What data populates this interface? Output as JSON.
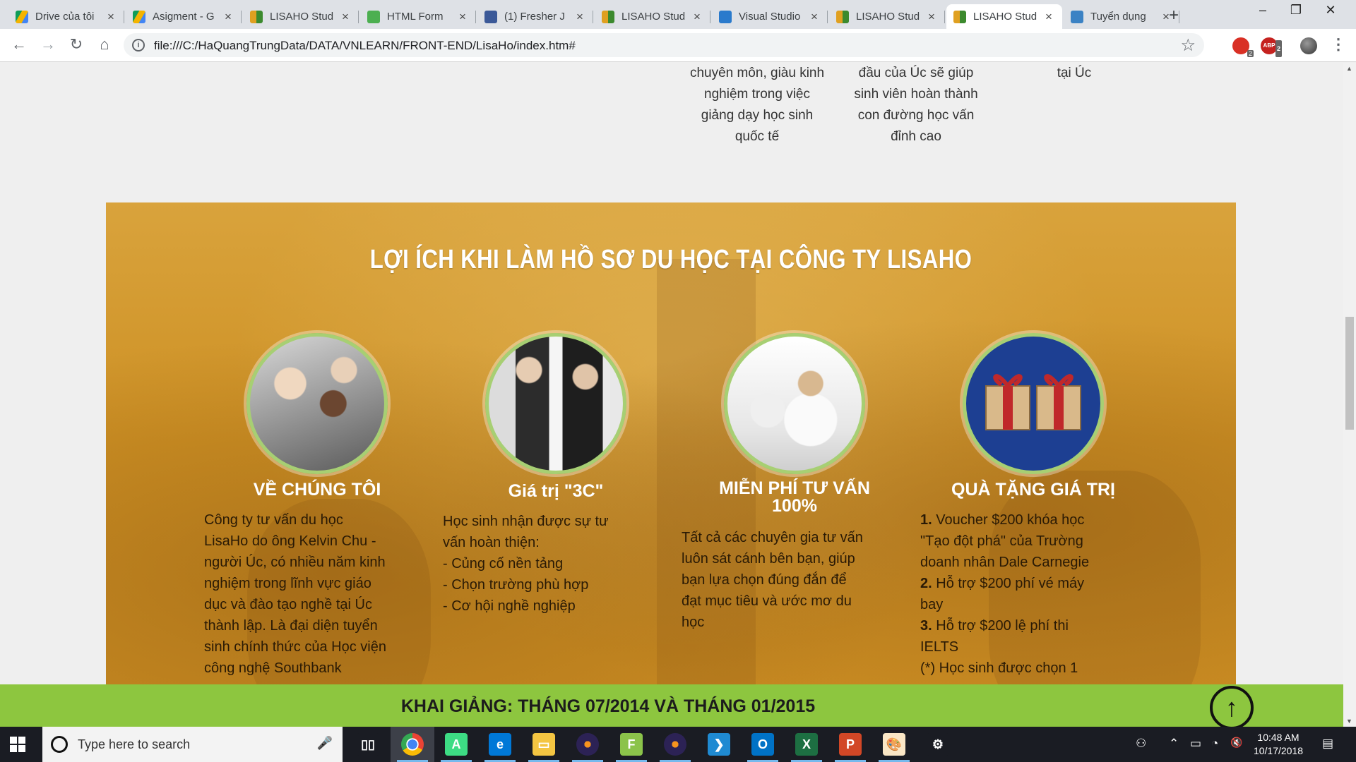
{
  "browser": {
    "tabs": [
      {
        "title": "Drive của tôi",
        "icon": "google-drive-icon",
        "close": "×"
      },
      {
        "title": "Asigment - G",
        "icon": "google-drive-icon",
        "close": "×"
      },
      {
        "title": "LISAHO Stud",
        "icon": "lisaho-favicon",
        "close": "×"
      },
      {
        "title": "HTML Form",
        "icon": "w3schools-favicon",
        "close": "×"
      },
      {
        "title": "(1) Fresher J",
        "icon": "facebook-favicon",
        "close": "×"
      },
      {
        "title": "LISAHO Stud",
        "icon": "lisaho-favicon",
        "close": "×"
      },
      {
        "title": "Visual Studio",
        "icon": "vscode-favicon",
        "close": "×"
      },
      {
        "title": "LISAHO Stud",
        "icon": "lisaho-favicon",
        "close": "×"
      },
      {
        "title": "LISAHO Stud",
        "icon": "lisaho-favicon",
        "close": "×",
        "active": true
      },
      {
        "title": "Tuyển dụng",
        "icon": "binoculars-favicon",
        "close": "×"
      }
    ],
    "new_tab": "+",
    "window_controls": {
      "minimize": "–",
      "restore": "❐",
      "close": "✕"
    },
    "nav": {
      "back": "←",
      "forward": "→",
      "reload": "↻",
      "home": "⌂"
    },
    "url": "file:///C:/HaQuangTrungData/DATA/VNLEARN/FRONT-END/LisaHo/index.htm#",
    "info_icon": "i",
    "bookmark_star": "☆",
    "extensions": [
      {
        "name": "extension-icon-1",
        "badge": "2"
      },
      {
        "name": "adblock-icon",
        "badge": "2",
        "label": "ABP"
      }
    ],
    "menu": "⋮",
    "colors": {
      "tabstrip": "#dee1e6",
      "active_tab": "#ffffff"
    }
  },
  "page": {
    "top_columns": [
      {
        "lines": [
          "chuyên môn, giàu kinh",
          "nghiệm trong việc",
          "giảng dạy học sinh",
          "quốc tế"
        ]
      },
      {
        "lines": [
          "đầu của Úc sẽ giúp",
          "sinh viên hoàn thành",
          "con đường học vấn",
          "đỉnh cao"
        ]
      },
      {
        "lines": [
          "tại Úc"
        ]
      }
    ],
    "benefits": {
      "title": "LỢI ÍCH KHI LÀM HỒ SƠ DU HỌC TẠI CÔNG TY LISAHO",
      "cards": [
        {
          "title": "VỀ CHÚNG TÔI",
          "image": "business-meeting-photo",
          "lines": [
            "Công ty tư vấn du học",
            "LisaHo do ông Kelvin Chu -",
            "người Úc, có nhiều năm kinh",
            "nghiệm trong lĩnh vực giáo",
            "dục và đào tạo nghề tại Úc",
            "thành lập. Là đại diện tuyển",
            "sinh chính thức của Học viện",
            "công nghệ Southbank"
          ]
        },
        {
          "title": "Giá trị \"3C\"",
          "image": "handshake-photo",
          "lines": [
            "Học sinh nhận được sự tư",
            "vấn hoàn thiện:",
            "- Củng cố nền tảng",
            "- Chọn trường phù hợp",
            "- Cơ hội nghề nghiệp"
          ]
        },
        {
          "title": "MIỄN PHÍ TƯ VẤN 100%",
          "title_lines": [
            "MIỄN PHÍ TƯ VẤN",
            "100%"
          ],
          "image": "call-center-photo",
          "lines": [
            "Tất cả các chuyên gia tư vấn",
            "luôn sát cánh bên bạn, giúp",
            "bạn lựa chọn đúng đắn để",
            "đạt mục tiêu và ước mơ du",
            "học"
          ]
        },
        {
          "title": "QUÀ TẶNG GIÁ TRỊ",
          "image": "gift-boxes-icon",
          "rich_lines": [
            {
              "num": "1.",
              "text": " Voucher $200 khóa học"
            },
            {
              "num": "",
              "text": "\"Tạo đột phá\" của Trường"
            },
            {
              "num": "",
              "text": "doanh nhân Dale Carnegie"
            },
            {
              "num": "2.",
              "text": " Hỗ trợ $200 phí vé máy"
            },
            {
              "num": "",
              "text": "bay"
            },
            {
              "num": "3.",
              "text": " Hỗ trợ $200 lệ phí thi"
            },
            {
              "num": "",
              "text": "IELTS"
            },
            {
              "num": "",
              "text": "(*) Học sinh được chọn 1"
            }
          ]
        }
      ],
      "colors": {
        "background": "#cd9024",
        "circle_border": "#a7cf73",
        "title": "#ffffff"
      }
    },
    "banner": {
      "text": "KHAI GIẢNG: THÁNG 07/2014 VÀ THÁNG 01/2015",
      "color": "#8dc63f"
    },
    "back_to_top": "↑"
  },
  "taskbar": {
    "search_placeholder": "Type here to search",
    "mic": "🎤",
    "apps": [
      "task-view-icon",
      "chrome-icon",
      "android-studio-icon",
      "edge-icon",
      "file-explorer-icon",
      "eclipse-icon",
      "fiddler-icon",
      "eclipse-icon-2",
      "vscode-icon",
      "outlook-icon",
      "excel-icon",
      "powerpoint-icon",
      "paint-icon",
      "settings-icon"
    ],
    "tray": {
      "people": "⚇",
      "chevron": "⌃",
      "battery": "▭",
      "wifi": "◔",
      "volume": "🔇",
      "notifications": "▤"
    },
    "time": "10:48 AM",
    "date": "10/17/2018"
  }
}
